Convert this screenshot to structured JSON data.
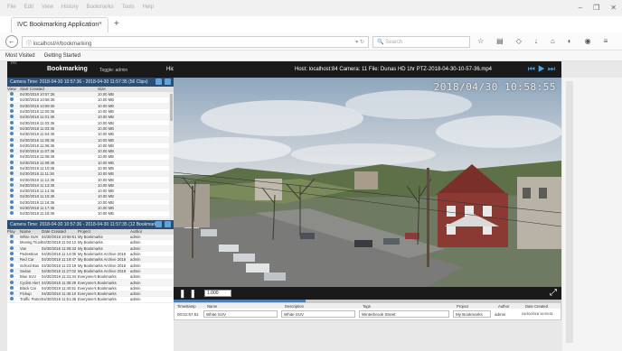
{
  "browser": {
    "menu": [
      "File",
      "Edit",
      "View",
      "History",
      "Bookmarks",
      "Tools",
      "Help"
    ],
    "tab_title": "IVC Bookmarking Application",
    "url": "localhost/#/bookmarking",
    "search_placeholder": "Search",
    "bookmarks": [
      "Most Visited",
      "Getting Started"
    ]
  },
  "app": {
    "logo": "IVC",
    "logo_sub": "Industrial Video & Control",
    "title": "Bookmarking",
    "user": "Toggle: admin",
    "hide_label": "Hide",
    "viewer_info": "Host: localhost:84 Camera: 11 File: Dunas HD 1hr PTZ-2018-04-30-10-57-36.mp4",
    "timestamp": "2018/04/30 10:58:55",
    "speed": "1.000"
  },
  "clips_panel": {
    "title": "Camera Time: 2018-04-30 10:57:36 - 2018-04-30 11:57:35 (56 Clips)",
    "columns": [
      "View",
      "Start Created",
      "Size"
    ],
    "rows": [
      {
        "date": "04/30/2018 10:57:36",
        "size": "10.00 MB"
      },
      {
        "date": "04/30/2018 10:58:36",
        "size": "10.00 MB"
      },
      {
        "date": "04/30/2018 10:59:36",
        "size": "10.00 MB"
      },
      {
        "date": "04/30/2018 11:00:36",
        "size": "10.00 MB"
      },
      {
        "date": "04/30/2018 11:01:36",
        "size": "10.00 MB"
      },
      {
        "date": "04/30/2018 11:02:36",
        "size": "10.00 MB"
      },
      {
        "date": "04/30/2018 11:03:36",
        "size": "10.00 MB"
      },
      {
        "date": "04/30/2018 11:04:36",
        "size": "10.00 MB"
      },
      {
        "date": "04/30/2018 11:05:36",
        "size": "10.00 MB"
      },
      {
        "date": "04/30/2018 11:06:36",
        "size": "10.00 MB"
      },
      {
        "date": "04/30/2018 11:07:36",
        "size": "10.00 MB"
      },
      {
        "date": "04/30/2018 11:08:36",
        "size": "10.00 MB"
      },
      {
        "date": "04/30/2018 11:09:36",
        "size": "10.00 MB"
      },
      {
        "date": "04/30/2018 11:10:36",
        "size": "10.00 MB"
      },
      {
        "date": "04/30/2018 11:11:36",
        "size": "10.00 MB"
      },
      {
        "date": "04/30/2018 11:12:36",
        "size": "10.00 MB"
      },
      {
        "date": "04/30/2018 11:13:36",
        "size": "10.00 MB"
      },
      {
        "date": "04/30/2018 11:14:36",
        "size": "10.00 MB"
      },
      {
        "date": "04/30/2018 11:15:36",
        "size": "10.00 MB"
      },
      {
        "date": "04/30/2018 11:16:36",
        "size": "10.00 MB"
      },
      {
        "date": "04/30/2018 11:17:36",
        "size": "10.00 MB"
      },
      {
        "date": "04/30/2018 11:18:36",
        "size": "10.00 MB"
      }
    ]
  },
  "bookmarks_panel": {
    "title": "Camera Time: 2018-04-30 10:57:36 - 2018-04-30 11:57:35 (12 Bookmarks)",
    "columns": [
      "Play",
      "Name",
      "Date Created",
      "Project",
      "Author"
    ],
    "rows": [
      {
        "name": "White SUV",
        "date": "04/30/2018 10:59:51",
        "project": "My Bookmarks",
        "author": "admin"
      },
      {
        "name": "Moving Truck",
        "date": "04/30/2018 11:04:12",
        "project": "My Bookmarks",
        "author": "admin"
      },
      {
        "name": "Van",
        "date": "04/30/2018 11:09:33",
        "project": "My Bookmarks",
        "author": "admin"
      },
      {
        "name": "Pedestrian",
        "date": "04/30/2018 11:14:05",
        "project": "My Bookmarks Archive 2018",
        "author": "admin"
      },
      {
        "name": "Red Car",
        "date": "04/30/2018 11:19:47",
        "project": "My Bookmarks Archive 2018",
        "author": "admin"
      },
      {
        "name": "School Bus",
        "date": "04/30/2018 11:23:18",
        "project": "My Bookmarks Archive 2018",
        "author": "admin"
      },
      {
        "name": "Sedan",
        "date": "04/30/2018 11:27:02",
        "project": "My Bookmarks Archive 2018",
        "author": "admin"
      },
      {
        "name": "Blue SUV",
        "date": "04/30/2018 11:31:44",
        "project": "Everyone's Bookmarks",
        "author": "admin"
      },
      {
        "name": "Cyclist Alert",
        "date": "04/30/2018 11:36:29",
        "project": "Everyone's Bookmarks",
        "author": "admin"
      },
      {
        "name": "Black Car",
        "date": "04/30/2018 11:40:51",
        "project": "Everyone's Bookmarks",
        "author": "admin"
      },
      {
        "name": "Pickup",
        "date": "04/30/2018 11:45:10",
        "project": "Everyone's Bookmarks",
        "author": "admin"
      },
      {
        "name": "Traffic Patrol",
        "date": "04/30/2018 11:51:36",
        "project": "Everyone's Bookmarks",
        "author": "admin"
      }
    ]
  },
  "bookmark_form": {
    "columns": [
      "Timestamp",
      "Name",
      "Description",
      "Tags",
      "Project",
      "Author",
      "Date Created"
    ],
    "timestamp": "00:01:57.51",
    "name": "White SUV",
    "description": "White SUV",
    "tags": "Winterbrook Street",
    "project": "My Bookmarks",
    "author": "admin",
    "date_created": "04/30/2018 10:59:51"
  },
  "progress": 0.34
}
